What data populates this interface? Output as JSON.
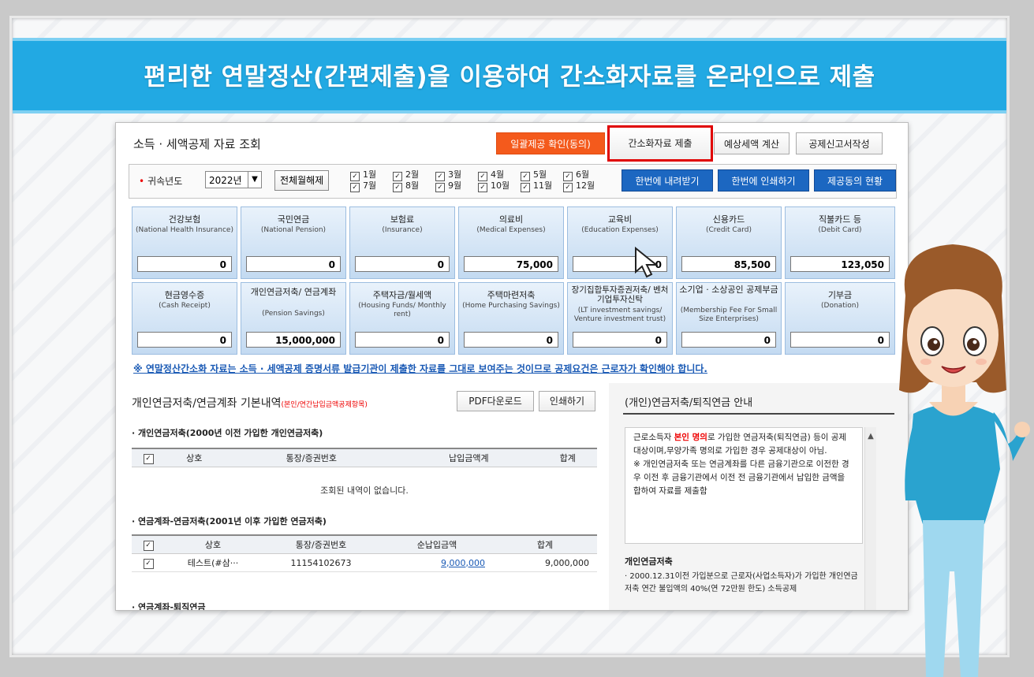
{
  "banner": {
    "title": "편리한 연말정산(간편제출)을 이용하여 간소화자료를 온라인으로 제출"
  },
  "panel": {
    "title": "소득 · 세액공제 자료 조회",
    "buttons": {
      "bulk_confirm": "일괄제공 확인(동의)",
      "submit": "간소화자료 제출",
      "estimate": "예상세액 계산",
      "deduction_form": "공제신고서작성"
    }
  },
  "yearbar": {
    "label": "귀속년도",
    "year": "2022년",
    "clear": "전체월해제",
    "months": [
      "1월",
      "2월",
      "3월",
      "4월",
      "5월",
      "6월",
      "7월",
      "8월",
      "9월",
      "10월",
      "11월",
      "12월"
    ],
    "download_all": "한번에 내려받기",
    "print_all": "한번에 인쇄하기",
    "consent_status": "제공동의 현황"
  },
  "cards": [
    {
      "label": "건강보험",
      "sub": "(National Health Insurance)",
      "value": "0"
    },
    {
      "label": "국민연금",
      "sub": "(National Pension)",
      "value": "0"
    },
    {
      "label": "보험료",
      "sub": "(Insurance)",
      "value": "0"
    },
    {
      "label": "의료비",
      "sub": "(Medical Expenses)",
      "value": "75,000"
    },
    {
      "label": "교육비",
      "sub": "(Education Expenses)",
      "value": "0"
    },
    {
      "label": "신용카드",
      "sub": "(Credit Card)",
      "value": "85,500"
    },
    {
      "label": "직불카드 등",
      "sub": "(Debit Card)",
      "value": "123,050"
    },
    {
      "label": "현금영수증",
      "sub": "(Cash Receipt)",
      "value": "0"
    },
    {
      "label": "개인연금저축/ 연금계좌",
      "sub": "(Pension Savings)",
      "value": "15,000,000"
    },
    {
      "label": "주택자금/월세액",
      "sub": "(Housing Funds/ Monthly rent)",
      "value": "0"
    },
    {
      "label": "주택마련저축",
      "sub": "(Home Purchasing Savings)",
      "value": "0"
    },
    {
      "label": "장기집합투자증권저축/ 벤처기업투자신탁",
      "sub": "(LT investment savings/ Venture investment trust)",
      "value": "0"
    },
    {
      "label": "소기업 · 소상공인 공제부금",
      "sub": "(Membership Fee For Small Size Enterprises)",
      "value": "0"
    },
    {
      "label": "기부금",
      "sub": "(Donation)",
      "value": "0"
    }
  ],
  "notice": "※ 연말정산간소화 자료는 소득 · 세액공제 증명서류 발급기관이 제출한 자료를 그대로 보여주는 것이므로 공제요건은 근로자가 확인해야 합니다.",
  "pension": {
    "title": "개인연금저축/연금계좌 기본내역",
    "title_note": "(본인/연간납입금액공제항목)",
    "pdf": "PDF다운로드",
    "print": "인쇄하기",
    "sec1": "개인연금저축(2000년 이전 가입한 개인연금저축)",
    "sec1_headers": [
      "상호",
      "통장/증권번호",
      "납입금액계",
      "합계"
    ],
    "sec1_empty": "조회된 내역이 없습니다.",
    "sec2": "연금계좌-연금저축(2001년 이후 가입한 연금저축)",
    "sec2_headers": [
      "상호",
      "통장/증권번호",
      "순납입금액",
      "합계"
    ],
    "sec2_rows": [
      {
        "name": "테스트(#삼···",
        "account": "11154102673",
        "amount": "9,000,000",
        "total": "9,000,000"
      }
    ],
    "sec3": "연금계좌-퇴직연금"
  },
  "guide": {
    "title": "(개인)연금저축/퇴직연금 안내",
    "box_pre": "근로소득자 ",
    "box_red": "본인 명의",
    "box_post": "로 가입한 연금저축(퇴직연금) 등이 공제 대상이며,무양가족 명의로 가입한 경우 공제대상이 아님.",
    "box_note": "※ 개인연금저축 또는 연금계좌를 다른 금융기관으로 이전한 경우 이전 후 금융기관에서 이전 전 금융기관에서 납입한 금액을 합하여 자료를 제출함",
    "sub": "개인연금저축",
    "text": "· 2000.12.31이전 가입분으로 근로자(사업소득자)가 가입한 개인연금저축 연간 불입액의 40%(연 72만원 한도) 소득공제"
  }
}
